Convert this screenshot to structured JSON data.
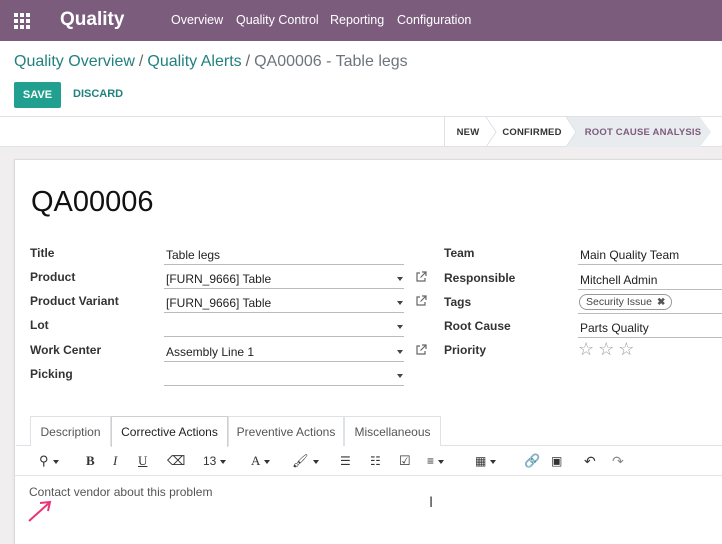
{
  "nav": {
    "app_title": "Quality",
    "menu": [
      "Overview",
      "Quality Control",
      "Reporting",
      "Configuration"
    ]
  },
  "breadcrumb": {
    "level1": "Quality Overview",
    "level2": "Quality Alerts",
    "current": "QA00006 - Table legs",
    "separator": "/"
  },
  "buttons": {
    "save": "SAVE",
    "discard": "DISCARD"
  },
  "stages": [
    "NEW",
    "CONFIRMED",
    "ROOT CAUSE ANALYSIS"
  ],
  "record": {
    "name": "QA00006",
    "left_fields": {
      "title_label": "Title",
      "title_value": "Table legs",
      "product_label": "Product",
      "product_value": "[FURN_9666] Table",
      "variant_label": "Product Variant",
      "variant_value": "[FURN_9666] Table",
      "lot_label": "Lot",
      "lot_value": "",
      "workcenter_label": "Work Center",
      "workcenter_value": "Assembly Line 1",
      "picking_label": "Picking",
      "picking_value": ""
    },
    "right_fields": {
      "team_label": "Team",
      "team_value": "Main Quality Team",
      "responsible_label": "Responsible",
      "responsible_value": "Mitchell Admin",
      "tags_label": "Tags",
      "tag_value": "Security Issue",
      "rootcause_label": "Root Cause",
      "rootcause_value": "Parts Quality",
      "priority_label": "Priority",
      "priority_stars": 0
    }
  },
  "tabs": [
    "Description",
    "Corrective Actions",
    "Preventive Actions",
    "Miscellaneous"
  ],
  "active_tab": "Corrective Actions",
  "toolbar": {
    "font_size": "13",
    "font_icon": "A",
    "bold": "B",
    "italic": "I",
    "underline": "U"
  },
  "editor": {
    "content": "Contact vendor about this problem"
  },
  "colors": {
    "navbar": "#7c5c7d",
    "primary_button": "#21a08f",
    "link": "#21817f",
    "arrow": "#e8337a"
  }
}
